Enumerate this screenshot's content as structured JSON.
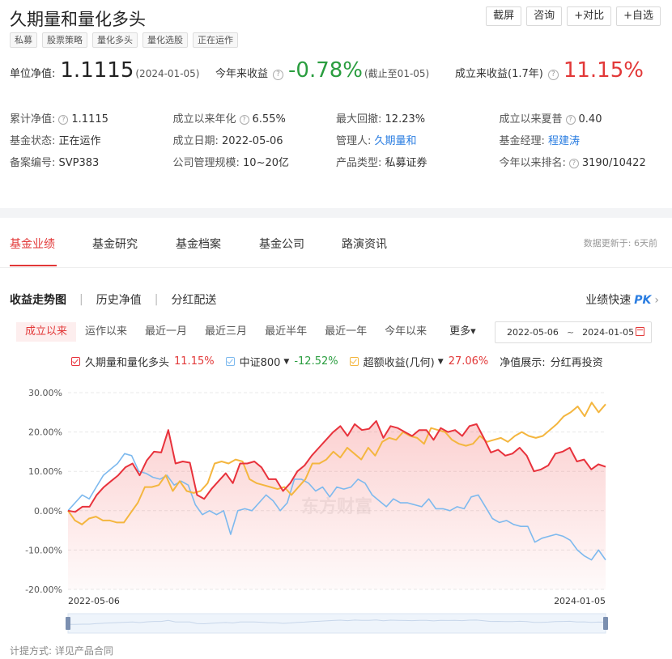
{
  "fund": {
    "name": "久期量和量化多头",
    "tags": [
      "私募",
      "股票策略",
      "量化多头",
      "量化选股",
      "正在运作"
    ]
  },
  "actions": {
    "fullscreen": "截屏",
    "consult": "咨询",
    "compare": "+对比",
    "favorite": "+自选"
  },
  "kpi": {
    "nav_label": "单位净值:",
    "nav_value": "1.1115",
    "nav_date": "(2024-01-05)",
    "ytd_label": "今年来收益",
    "ytd_value": "-0.78%",
    "ytd_note": "(截止至01-05)",
    "since_label": "成立来收益(1.7年)",
    "since_value": "11.15%"
  },
  "stats": [
    [
      {
        "key": "累计净值:",
        "value": "1.1115",
        "help": true
      },
      {
        "key": "成立以来年化",
        "value": "6.55%",
        "help": true
      },
      {
        "key": "最大回撤:",
        "value": "12.23%"
      },
      {
        "key": "成立以来夏普",
        "value": "0.40",
        "help": true
      }
    ],
    [
      {
        "key": "基金状态:",
        "value": "正在运作"
      },
      {
        "key": "成立日期:",
        "value": "2022-05-06"
      },
      {
        "key": "管理人:",
        "value": "久期量和",
        "link": true
      },
      {
        "key": "基金经理:",
        "value": "程建涛",
        "link": true
      }
    ],
    [
      {
        "key": "备案编号:",
        "value": "SVP383"
      },
      {
        "key": "公司管理规模:",
        "value": "10~20亿"
      },
      {
        "key": "产品类型:",
        "value": "私募证券"
      },
      {
        "key": "今年以来排名:",
        "value": "3190/10422",
        "help": true
      }
    ]
  ],
  "tabs": [
    "基金业绩",
    "基金研究",
    "基金档案",
    "基金公司",
    "路演资讯"
  ],
  "update_note": "数据更新于: 6天前",
  "subtabs": [
    "收益走势图",
    "历史净值",
    "分红配送"
  ],
  "quick_label": "业绩快速",
  "quick_pk": "PK",
  "ranges": [
    "成立以来",
    "运作以来",
    "最近一月",
    "最近三月",
    "最近半年",
    "最近一年",
    "今年以来"
  ],
  "more_label": "更多▾",
  "date_from": "2022-05-06",
  "date_to": "2024-01-05",
  "legend": [
    {
      "name": "久期量和量化多头",
      "value": "11.15%",
      "color": "#e8323c",
      "value_color": "#e23838",
      "dropdown": false
    },
    {
      "name": "中证800",
      "value": "-12.52%",
      "color": "#7db9ee",
      "value_color": "#2a9d3f",
      "dropdown": true
    },
    {
      "name": "超额收益(几何)",
      "value": "27.06%",
      "color": "#f4b63f",
      "value_color": "#e23838",
      "dropdown": true
    }
  ],
  "nav_display_label": "净值展示:",
  "nav_display_value": "分红再投资",
  "watermark": "东方财富",
  "footer": "计提方式: 详见产品合同",
  "chart_data": {
    "type": "line",
    "ylim": [
      -20,
      30
    ],
    "yticks": [
      "30.00%",
      "20.00%",
      "10.00%",
      "0.00%",
      "-10.00%",
      "-20.00%"
    ],
    "x_start": "2022-05-06",
    "x_end": "2024-01-05",
    "series": [
      {
        "name": "久期量和量化多头",
        "color": "#e8323c",
        "area": true,
        "values": [
          0.0,
          -0.3,
          1.0,
          1.0,
          4.0,
          6.0,
          7.5,
          9.0,
          11.0,
          12.0,
          9.0,
          12.8,
          15.0,
          14.8,
          20.5,
          12.0,
          12.5,
          12.2,
          4.0,
          3.0,
          5.5,
          7.5,
          9.5,
          7.0,
          12.0,
          12.0,
          12.5,
          11.0,
          8.0,
          8.0,
          5.0,
          7.0,
          10.0,
          11.5,
          14.0,
          16.0,
          18.0,
          20.0,
          21.5,
          19.0,
          22.0,
          20.5,
          20.8,
          22.8,
          18.5,
          21.5,
          21.0,
          20.0,
          19.0,
          20.5,
          20.5,
          18.0,
          21.0,
          20.0,
          20.5,
          19.0,
          21.5,
          22.0,
          18.5,
          14.8,
          15.5,
          14.0,
          14.5,
          16.0,
          14.0,
          10.0,
          10.5,
          11.5,
          14.5,
          15.0,
          16.0,
          12.5,
          13.0,
          10.5,
          11.8,
          11.15
        ]
      },
      {
        "name": "中证800",
        "color": "#7db9ee",
        "area": false,
        "values": [
          0.0,
          2.0,
          4.0,
          3.0,
          6.0,
          9.0,
          10.5,
          12.0,
          14.5,
          14.0,
          10.0,
          9.5,
          8.5,
          8.0,
          9.0,
          6.5,
          7.5,
          6.5,
          1.5,
          -1.0,
          0.0,
          -1.0,
          0.0,
          -6.0,
          0.0,
          0.5,
          0.0,
          2.0,
          4.0,
          2.5,
          0.0,
          2.0,
          8.0,
          8.0,
          7.0,
          5.0,
          6.0,
          3.5,
          6.0,
          5.5,
          6.0,
          8.0,
          7.0,
          4.0,
          2.5,
          1.0,
          3.0,
          2.0,
          2.0,
          1.5,
          1.0,
          3.0,
          0.5,
          0.5,
          0.0,
          1.0,
          0.5,
          3.5,
          4.0,
          1.0,
          -2.0,
          -3.0,
          -2.5,
          -3.5,
          -4.0,
          -4.0,
          -8.0,
          -7.0,
          -6.5,
          -6.0,
          -6.5,
          -7.5,
          -10.0,
          -11.5,
          -12.5,
          -10.0,
          -12.52
        ]
      },
      {
        "name": "超额收益(几何)",
        "color": "#f4b63f",
        "area": false,
        "values": [
          0.0,
          -2.5,
          -3.5,
          -2.0,
          -1.5,
          -2.5,
          -2.5,
          -3.0,
          -3.0,
          -0.5,
          2.0,
          6.0,
          6.0,
          6.5,
          9.0,
          5.0,
          7.5,
          5.0,
          4.5,
          5.0,
          7.0,
          12.0,
          12.5,
          12.0,
          13.0,
          12.5,
          8.0,
          7.0,
          6.5,
          6.0,
          5.5,
          6.0,
          4.0,
          6.0,
          8.0,
          12.0,
          12.0,
          13.0,
          15.0,
          13.5,
          16.0,
          14.5,
          13.0,
          16.0,
          14.0,
          17.5,
          18.5,
          18.0,
          20.0,
          19.0,
          18.5,
          17.0,
          21.0,
          20.5,
          20.0,
          18.0,
          17.0,
          16.5,
          17.0,
          19.0,
          17.5,
          18.0,
          18.5,
          17.5,
          19.0,
          20.0,
          19.0,
          18.5,
          19.0,
          20.5,
          22.0,
          24.0,
          25.0,
          26.5,
          24.0,
          27.5,
          25.0,
          27.06
        ]
      }
    ]
  }
}
